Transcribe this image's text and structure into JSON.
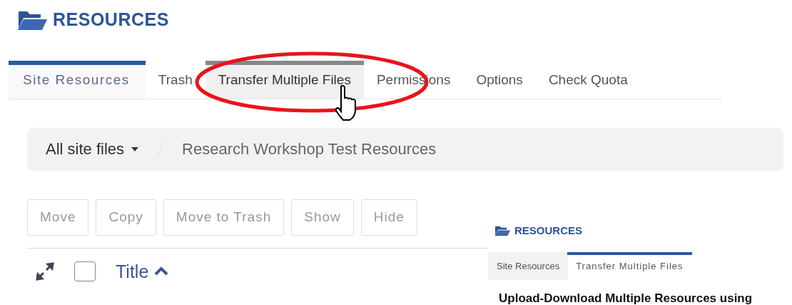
{
  "header": {
    "title": "RESOURCES"
  },
  "tabs": [
    {
      "label": "Site Resources",
      "selected": true,
      "hovered": false
    },
    {
      "label": "Trash",
      "selected": false,
      "hovered": false
    },
    {
      "label": "Transfer Multiple Files",
      "selected": false,
      "hovered": true
    },
    {
      "label": "Permissions",
      "selected": false,
      "hovered": false
    },
    {
      "label": "Options",
      "selected": false,
      "hovered": false
    },
    {
      "label": "Check Quota",
      "selected": false,
      "hovered": false
    }
  ],
  "breadcrumb": {
    "dropdown": "All site files",
    "current": "Research Workshop Test Resources"
  },
  "actions": [
    "Move",
    "Copy",
    "Move to Trash",
    "Show",
    "Hide"
  ],
  "table": {
    "select_all": {
      "checked": false
    },
    "columns": [
      {
        "label": "Title",
        "sorted_ascending": true
      }
    ]
  },
  "inset": {
    "title": "RESOURCES",
    "tabs": [
      {
        "label": "Site Resources",
        "selected": false
      },
      {
        "label": "Transfer Multiple Files",
        "selected": true
      }
    ],
    "heading": "Upload-Download Multiple Resources using"
  }
}
